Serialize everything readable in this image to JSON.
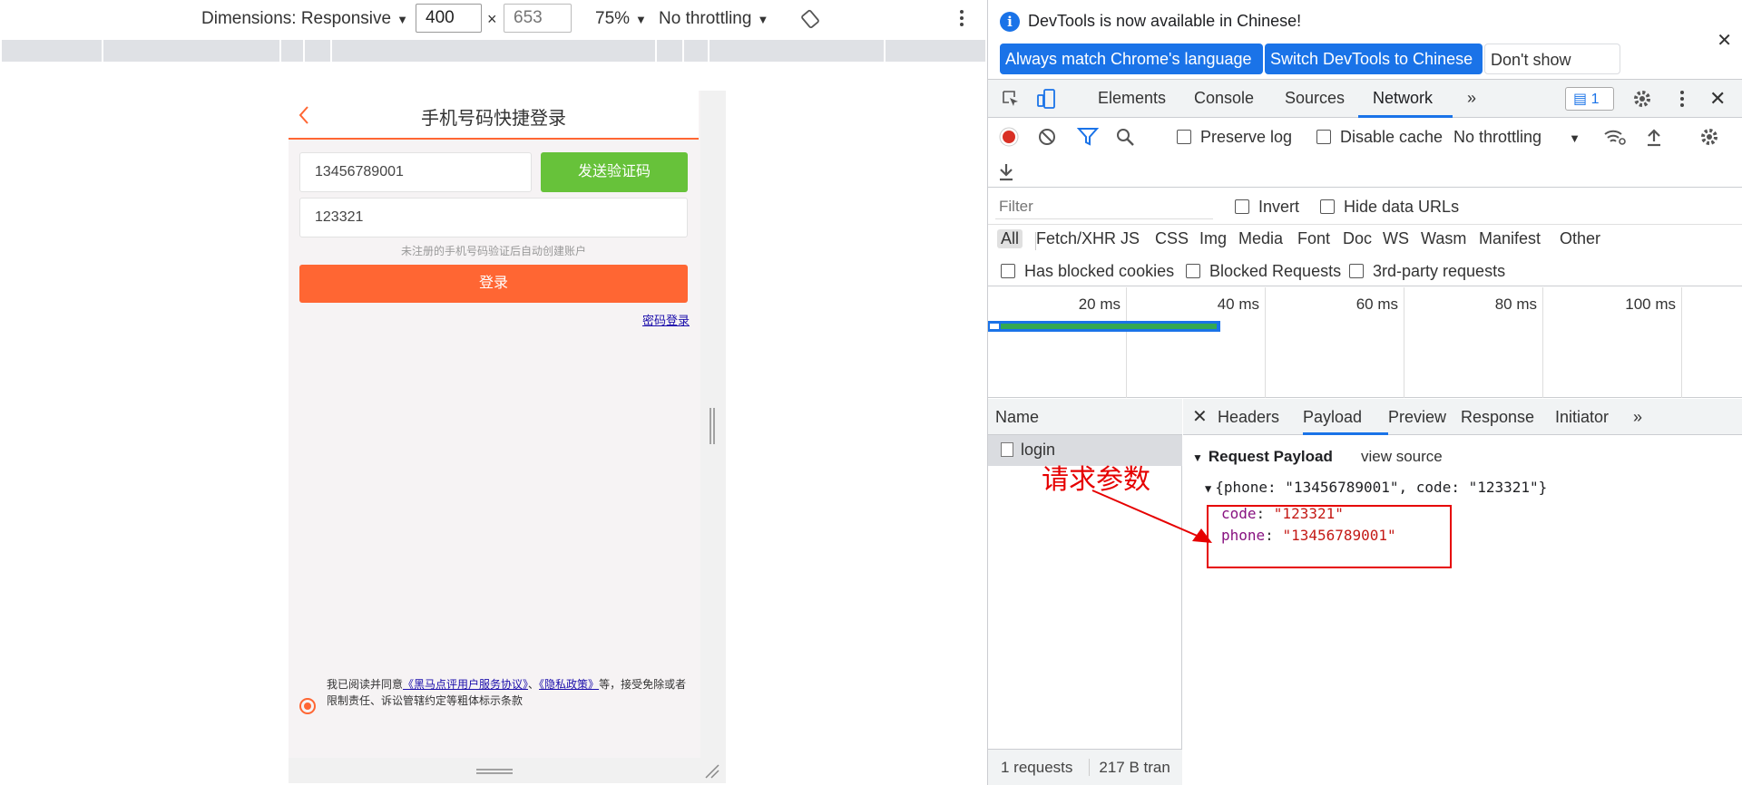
{
  "emulator": {
    "dimensions_label": "Dimensions: Responsive",
    "width": "400",
    "height_placeholder": "653",
    "times": "×",
    "zoom": "75%",
    "throttling": "No throttling"
  },
  "app": {
    "title": "手机号码快捷登录",
    "phone_value": "13456789001",
    "send_code_label": "发送验证码",
    "code_value": "123321",
    "hint": "未注册的手机号码验证后自动创建账户",
    "login_label": "登录",
    "password_login": "密码登录",
    "agree_prefix": "我已阅读并同意",
    "agree_link1": "《黑马点评用户服务协议》",
    "agree_sep": "、",
    "agree_link2": "《隐私政策》",
    "agree_suffix": "等，接受免除或者限制责任、诉讼管辖约定等粗体标示条款"
  },
  "devtools": {
    "info_message": "DevTools is now available in Chinese!",
    "btn_match": "Always match Chrome's language",
    "btn_switch": "Switch DevTools to Chinese",
    "btn_dontshow": "Don't show again",
    "tabs": [
      "Elements",
      "Console",
      "Sources",
      "Network"
    ],
    "issues_count": "1",
    "preserve_log": "Preserve log",
    "disable_cache": "Disable cache",
    "throttling": "No throttling",
    "filter_placeholder": "Filter",
    "invert": "Invert",
    "hide_data_urls": "Hide data URLs",
    "types": [
      "All",
      "Fetch/XHR",
      "JS",
      "CSS",
      "Img",
      "Media",
      "Font",
      "Doc",
      "WS",
      "Wasm",
      "Manifest",
      "Other"
    ],
    "has_blocked_cookies": "Has blocked cookies",
    "blocked_requests": "Blocked Requests",
    "third_party": "3rd-party requests",
    "timeline_labels": [
      "20 ms",
      "40 ms",
      "60 ms",
      "80 ms",
      "100 ms"
    ],
    "name_header": "Name",
    "request_name": "login",
    "status_requests": "1 requests",
    "status_transfer": "217 B tran",
    "detail_tabs": [
      "Headers",
      "Payload",
      "Preview",
      "Response",
      "Initiator"
    ],
    "payload_title": "Request Payload",
    "view_source": "view source",
    "payload_summary": "{phone: \"13456789001\", code: \"123321\"}",
    "code_key": "code",
    "code_val": "\"123321\"",
    "phone_key": "phone",
    "phone_val": "\"13456789001\""
  },
  "annotation": {
    "text": "请求参数",
    "color": "#e60000"
  },
  "colors": {
    "accent_orange": "#ff6633",
    "send_green": "#67c23a",
    "devtools_blue": "#1a73e8"
  }
}
